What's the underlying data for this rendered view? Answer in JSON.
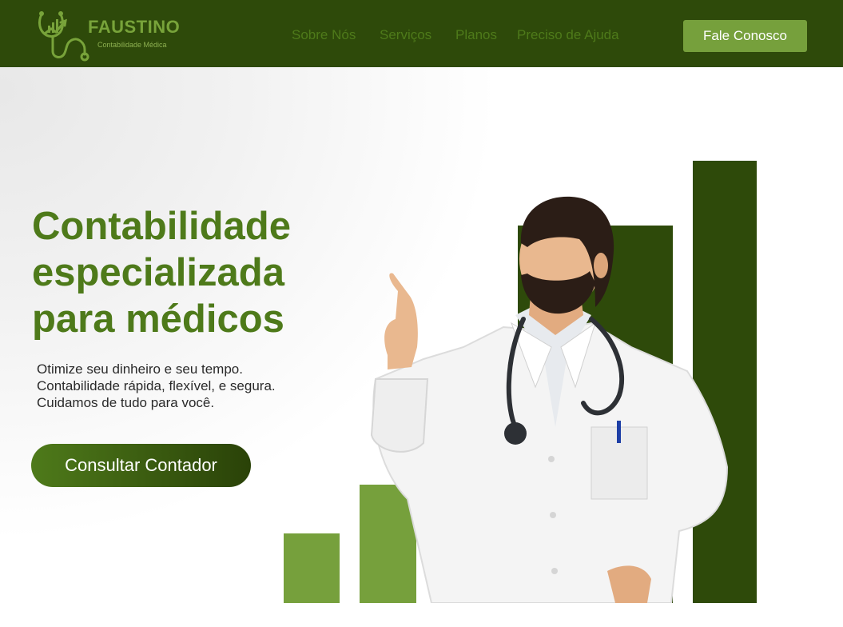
{
  "header": {
    "brand_name": "FAUSTINO",
    "brand_tagline": "Contabilidade Médica",
    "nav": [
      {
        "label": "Sobre Nós"
      },
      {
        "label": "Serviços"
      },
      {
        "label": "Planos"
      },
      {
        "label": "Preciso de Ajuda"
      }
    ],
    "cta_label": "Fale Conosco"
  },
  "hero": {
    "headline_lines": [
      "Contabilidade",
      "especializada",
      "para médicos"
    ],
    "subtext": "Otimize seu dinheiro e seu tempo. Contabilidade rápida, flexível, e segura. Cuidamos de tudo para você.",
    "cta_label": "Consultar Contador",
    "illustration": {
      "subject": "doctor-pointing-up",
      "bar_colors": [
        "#76a03c",
        "#76a03c",
        "#4e7a1a",
        "#2e4a0a",
        "#2e4a0a"
      ]
    }
  },
  "colors": {
    "header_bg": "#2e4a0a",
    "brand_green": "#78a33a",
    "nav_text": "#4e7a1a",
    "headline": "#4e7a1a",
    "button_light": "#76a03c",
    "button_dark": "#2a4208"
  }
}
